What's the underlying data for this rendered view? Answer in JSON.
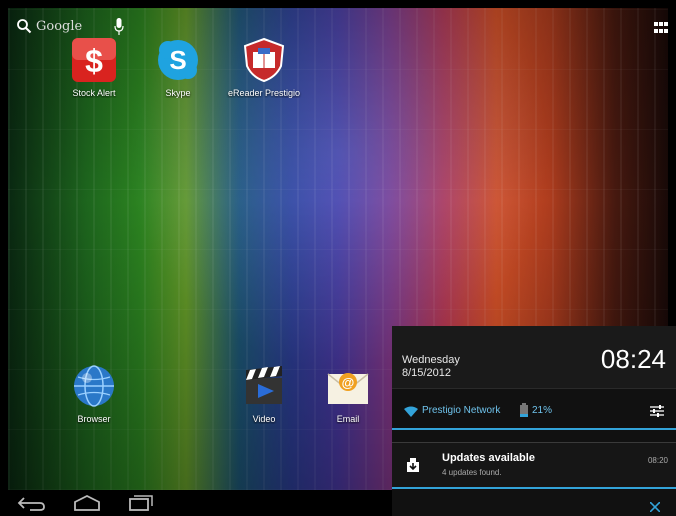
{
  "search": {
    "label": "Google"
  },
  "apps": [
    {
      "id": "stock-alert",
      "label": "Stock Alert",
      "icon": "dollar-icon",
      "color": "#d9231f"
    },
    {
      "id": "skype",
      "label": "Skype",
      "icon": "skype-icon",
      "color": "#1fa3e0"
    },
    {
      "id": "ereader",
      "label": "eReader Prestigio",
      "icon": "book-shield-icon",
      "color": "#c62a2a"
    },
    {
      "id": "browser",
      "label": "Browser",
      "icon": "globe-icon",
      "color": "#2a78c8"
    },
    {
      "id": "video",
      "label": "Video",
      "icon": "clapperboard-icon",
      "color": "#2a6cd8"
    },
    {
      "id": "email",
      "label": "Email",
      "icon": "envelope-icon",
      "color": "#f0a020"
    }
  ],
  "notification_panel": {
    "day": "Wednesday",
    "date": "8/15/2012",
    "time": "08:24",
    "network": "Prestigio Network",
    "battery": "21%",
    "accent_color": "#33a3d9",
    "notifications": [
      {
        "title": "Updates available",
        "subtitle": "4 updates found.",
        "time": "08:20",
        "icon": "download-icon"
      }
    ]
  }
}
